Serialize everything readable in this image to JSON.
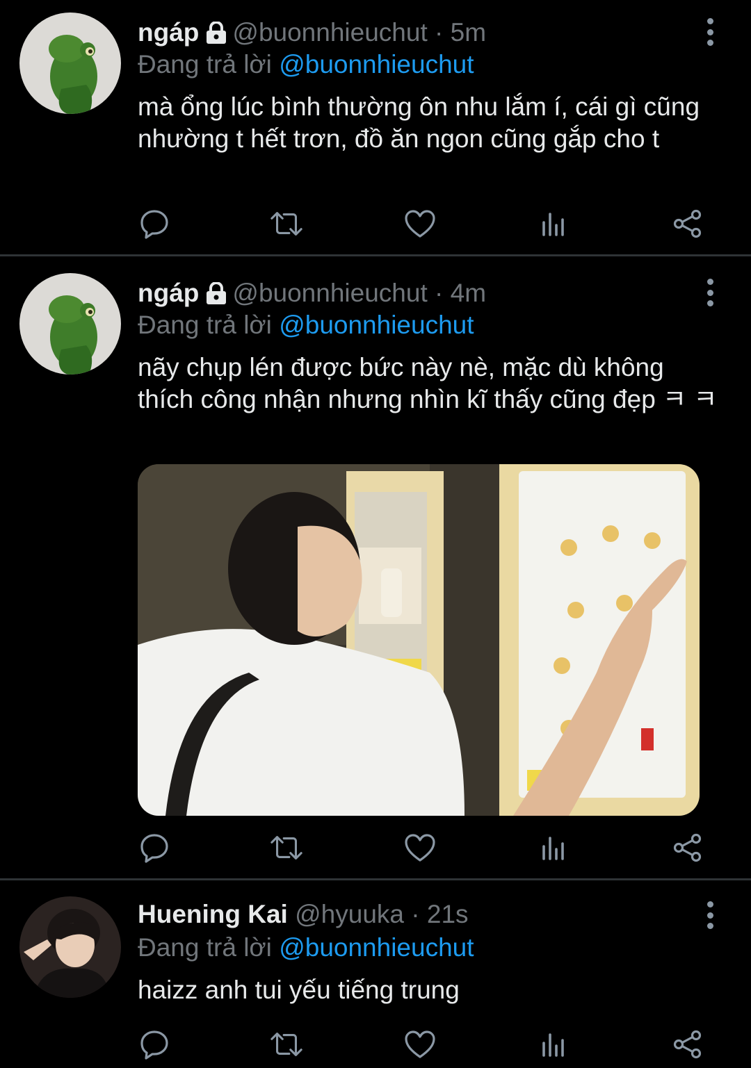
{
  "tweets": [
    {
      "name": "ngáp",
      "handle": "@buonnhieuchut",
      "separator": "·",
      "time": "5m",
      "locked": true,
      "replying_prefix": "Đang trả lời",
      "replying_to": "@buonnhieuchut",
      "text": "mà ổng lúc bình thường ôn nhu lắm í, cái gì cũng nhường t hết trơn, đồ ăn ngon cũng gắp cho t"
    },
    {
      "name": "ngáp",
      "handle": "@buonnhieuchut",
      "separator": "·",
      "time": "4m",
      "locked": true,
      "replying_prefix": "Đang trả lời",
      "replying_to": "@buonnhieuchut",
      "text": "nãy chụp lén được bức này nè, mặc dù không thích công nhận nhưng nhìn kĩ thấy cũng đẹp ㅋ ㅋ",
      "media": "photo"
    },
    {
      "name": "Huening Kai",
      "handle": "@hyuuka",
      "separator": "·",
      "time": "21s",
      "locked": false,
      "replying_prefix": "Đang trả lời",
      "replying_to": "@buonnhieuchut",
      "text": "haizz anh tui yếu tiếng trung"
    }
  ],
  "action_icons": [
    "reply-icon",
    "retweet-icon",
    "like-icon",
    "analytics-icon",
    "share-icon"
  ],
  "colors": {
    "background": "#000000",
    "text": "#e7e9ea",
    "secondary": "#71767b",
    "mention": "#1d9bf0",
    "divider": "#2f3336"
  }
}
